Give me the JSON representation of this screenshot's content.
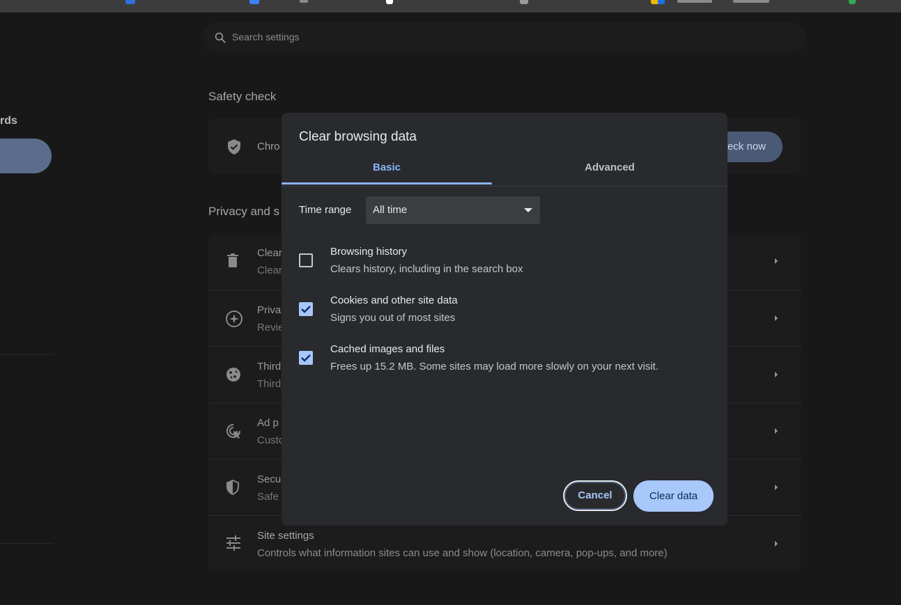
{
  "search": {
    "placeholder": "Search settings"
  },
  "sidebar": {
    "partial_label": "rds"
  },
  "safety_check": {
    "title": "Safety check",
    "row_text": "Chro",
    "button_label": "eck now"
  },
  "privacy": {
    "title": "Privacy and s",
    "rows": [
      {
        "title": "Clear",
        "subtitle": "Clear",
        "icon": "trash-icon"
      },
      {
        "title": "Priva",
        "subtitle": "Revie",
        "icon": "compass-icon"
      },
      {
        "title": "Third",
        "subtitle": "Third",
        "icon": "cookie-icon"
      },
      {
        "title": "Ad p",
        "subtitle": "Custo",
        "icon": "ad-privacy-icon"
      },
      {
        "title": "Secu",
        "subtitle": "Safe",
        "icon": "shield-icon"
      },
      {
        "title": "Site settings",
        "subtitle": "Controls what information sites can use and show (location, camera, pop-ups, and more)",
        "icon": "sliders-icon"
      }
    ]
  },
  "dialog": {
    "title": "Clear browsing data",
    "tabs": [
      {
        "label": "Basic",
        "active": true
      },
      {
        "label": "Advanced",
        "active": false
      }
    ],
    "time_range": {
      "label": "Time range",
      "value": "All time"
    },
    "options": [
      {
        "title": "Browsing history",
        "description": "Clears history, including in the search box",
        "checked": false
      },
      {
        "title": "Cookies and other site data",
        "description": "Signs you out of most sites",
        "checked": true
      },
      {
        "title": "Cached images and files",
        "description": "Frees up 15.2 MB. Some sites may load more slowly on your next visit.",
        "checked": true
      }
    ],
    "cancel_label": "Cancel",
    "confirm_label": "Clear data"
  },
  "colors": {
    "accent": "#8ab4f8",
    "checkbox_checked": "#a8c7fa",
    "dialog_bg": "#292a2d",
    "page_bg": "#181818"
  }
}
